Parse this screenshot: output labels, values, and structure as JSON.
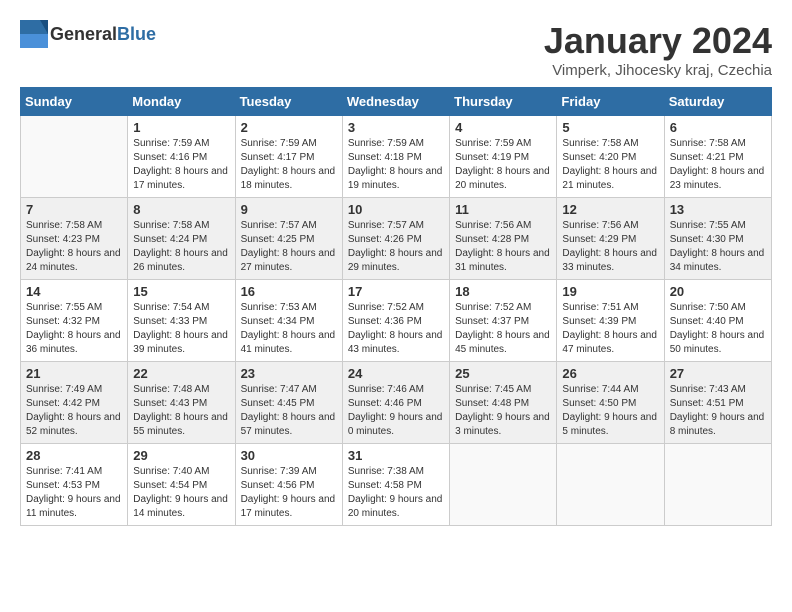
{
  "logo": {
    "general": "General",
    "blue": "Blue"
  },
  "title": "January 2024",
  "location": "Vimperk, Jihocesky kraj, Czechia",
  "days_of_week": [
    "Sunday",
    "Monday",
    "Tuesday",
    "Wednesday",
    "Thursday",
    "Friday",
    "Saturday"
  ],
  "weeks": [
    [
      {
        "day": "",
        "sunrise": "",
        "sunset": "",
        "daylight": ""
      },
      {
        "day": "1",
        "sunrise": "Sunrise: 7:59 AM",
        "sunset": "Sunset: 4:16 PM",
        "daylight": "Daylight: 8 hours and 17 minutes."
      },
      {
        "day": "2",
        "sunrise": "Sunrise: 7:59 AM",
        "sunset": "Sunset: 4:17 PM",
        "daylight": "Daylight: 8 hours and 18 minutes."
      },
      {
        "day": "3",
        "sunrise": "Sunrise: 7:59 AM",
        "sunset": "Sunset: 4:18 PM",
        "daylight": "Daylight: 8 hours and 19 minutes."
      },
      {
        "day": "4",
        "sunrise": "Sunrise: 7:59 AM",
        "sunset": "Sunset: 4:19 PM",
        "daylight": "Daylight: 8 hours and 20 minutes."
      },
      {
        "day": "5",
        "sunrise": "Sunrise: 7:58 AM",
        "sunset": "Sunset: 4:20 PM",
        "daylight": "Daylight: 8 hours and 21 minutes."
      },
      {
        "day": "6",
        "sunrise": "Sunrise: 7:58 AM",
        "sunset": "Sunset: 4:21 PM",
        "daylight": "Daylight: 8 hours and 23 minutes."
      }
    ],
    [
      {
        "day": "7",
        "sunrise": "Sunrise: 7:58 AM",
        "sunset": "Sunset: 4:23 PM",
        "daylight": "Daylight: 8 hours and 24 minutes."
      },
      {
        "day": "8",
        "sunrise": "Sunrise: 7:58 AM",
        "sunset": "Sunset: 4:24 PM",
        "daylight": "Daylight: 8 hours and 26 minutes."
      },
      {
        "day": "9",
        "sunrise": "Sunrise: 7:57 AM",
        "sunset": "Sunset: 4:25 PM",
        "daylight": "Daylight: 8 hours and 27 minutes."
      },
      {
        "day": "10",
        "sunrise": "Sunrise: 7:57 AM",
        "sunset": "Sunset: 4:26 PM",
        "daylight": "Daylight: 8 hours and 29 minutes."
      },
      {
        "day": "11",
        "sunrise": "Sunrise: 7:56 AM",
        "sunset": "Sunset: 4:28 PM",
        "daylight": "Daylight: 8 hours and 31 minutes."
      },
      {
        "day": "12",
        "sunrise": "Sunrise: 7:56 AM",
        "sunset": "Sunset: 4:29 PM",
        "daylight": "Daylight: 8 hours and 33 minutes."
      },
      {
        "day": "13",
        "sunrise": "Sunrise: 7:55 AM",
        "sunset": "Sunset: 4:30 PM",
        "daylight": "Daylight: 8 hours and 34 minutes."
      }
    ],
    [
      {
        "day": "14",
        "sunrise": "Sunrise: 7:55 AM",
        "sunset": "Sunset: 4:32 PM",
        "daylight": "Daylight: 8 hours and 36 minutes."
      },
      {
        "day": "15",
        "sunrise": "Sunrise: 7:54 AM",
        "sunset": "Sunset: 4:33 PM",
        "daylight": "Daylight: 8 hours and 39 minutes."
      },
      {
        "day": "16",
        "sunrise": "Sunrise: 7:53 AM",
        "sunset": "Sunset: 4:34 PM",
        "daylight": "Daylight: 8 hours and 41 minutes."
      },
      {
        "day": "17",
        "sunrise": "Sunrise: 7:52 AM",
        "sunset": "Sunset: 4:36 PM",
        "daylight": "Daylight: 8 hours and 43 minutes."
      },
      {
        "day": "18",
        "sunrise": "Sunrise: 7:52 AM",
        "sunset": "Sunset: 4:37 PM",
        "daylight": "Daylight: 8 hours and 45 minutes."
      },
      {
        "day": "19",
        "sunrise": "Sunrise: 7:51 AM",
        "sunset": "Sunset: 4:39 PM",
        "daylight": "Daylight: 8 hours and 47 minutes."
      },
      {
        "day": "20",
        "sunrise": "Sunrise: 7:50 AM",
        "sunset": "Sunset: 4:40 PM",
        "daylight": "Daylight: 8 hours and 50 minutes."
      }
    ],
    [
      {
        "day": "21",
        "sunrise": "Sunrise: 7:49 AM",
        "sunset": "Sunset: 4:42 PM",
        "daylight": "Daylight: 8 hours and 52 minutes."
      },
      {
        "day": "22",
        "sunrise": "Sunrise: 7:48 AM",
        "sunset": "Sunset: 4:43 PM",
        "daylight": "Daylight: 8 hours and 55 minutes."
      },
      {
        "day": "23",
        "sunrise": "Sunrise: 7:47 AM",
        "sunset": "Sunset: 4:45 PM",
        "daylight": "Daylight: 8 hours and 57 minutes."
      },
      {
        "day": "24",
        "sunrise": "Sunrise: 7:46 AM",
        "sunset": "Sunset: 4:46 PM",
        "daylight": "Daylight: 9 hours and 0 minutes."
      },
      {
        "day": "25",
        "sunrise": "Sunrise: 7:45 AM",
        "sunset": "Sunset: 4:48 PM",
        "daylight": "Daylight: 9 hours and 3 minutes."
      },
      {
        "day": "26",
        "sunrise": "Sunrise: 7:44 AM",
        "sunset": "Sunset: 4:50 PM",
        "daylight": "Daylight: 9 hours and 5 minutes."
      },
      {
        "day": "27",
        "sunrise": "Sunrise: 7:43 AM",
        "sunset": "Sunset: 4:51 PM",
        "daylight": "Daylight: 9 hours and 8 minutes."
      }
    ],
    [
      {
        "day": "28",
        "sunrise": "Sunrise: 7:41 AM",
        "sunset": "Sunset: 4:53 PM",
        "daylight": "Daylight: 9 hours and 11 minutes."
      },
      {
        "day": "29",
        "sunrise": "Sunrise: 7:40 AM",
        "sunset": "Sunset: 4:54 PM",
        "daylight": "Daylight: 9 hours and 14 minutes."
      },
      {
        "day": "30",
        "sunrise": "Sunrise: 7:39 AM",
        "sunset": "Sunset: 4:56 PM",
        "daylight": "Daylight: 9 hours and 17 minutes."
      },
      {
        "day": "31",
        "sunrise": "Sunrise: 7:38 AM",
        "sunset": "Sunset: 4:58 PM",
        "daylight": "Daylight: 9 hours and 20 minutes."
      },
      {
        "day": "",
        "sunrise": "",
        "sunset": "",
        "daylight": ""
      },
      {
        "day": "",
        "sunrise": "",
        "sunset": "",
        "daylight": ""
      },
      {
        "day": "",
        "sunrise": "",
        "sunset": "",
        "daylight": ""
      }
    ]
  ]
}
